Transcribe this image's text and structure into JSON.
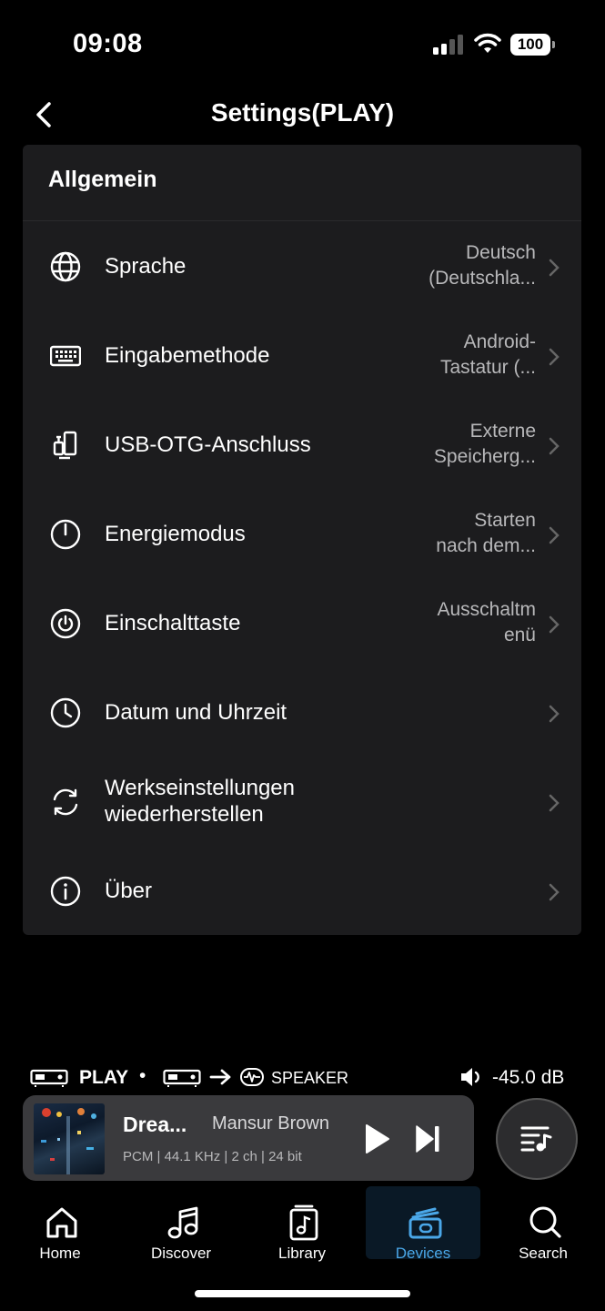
{
  "status_bar": {
    "time": "09:08",
    "battery": "100"
  },
  "header": {
    "title": "Settings(PLAY)"
  },
  "section": {
    "title": "Allgemein"
  },
  "settings": [
    {
      "label": "Sprache",
      "value_line1": "Deutsch",
      "value_line2": "(Deutschla...",
      "icon": "globe-icon"
    },
    {
      "label": "Eingabemethode",
      "value_line1": "Android-",
      "value_line2": "Tastatur (...",
      "icon": "keyboard-icon"
    },
    {
      "label": "USB-OTG-Anschluss",
      "value_line1": "Externe",
      "value_line2": "Speicherg...",
      "icon": "usb-device-icon"
    },
    {
      "label": "Energiemodus",
      "value_line1": "Starten",
      "value_line2": "nach dem...",
      "icon": "power-icon"
    },
    {
      "label": "Einschalttaste",
      "value_line1": "Ausschaltm",
      "value_line2": "enü",
      "icon": "power-button-icon"
    },
    {
      "label": "Datum und Uhrzeit",
      "value_line1": "",
      "value_line2": "",
      "icon": "clock-icon"
    },
    {
      "label_line1": "Werkseinstellungen",
      "label_line2": "wiederherstellen",
      "icon": "reset-icon"
    },
    {
      "label": "Über",
      "value_line1": "",
      "value_line2": "",
      "icon": "info-icon"
    }
  ],
  "output_chain": {
    "device": "PLAY",
    "separator": "•",
    "target": "SPEAKER",
    "volume": "-45.0 dB"
  },
  "player": {
    "title": "Drea...",
    "artist": "Mansur Brown",
    "meta": "PCM | 44.1 KHz | 2 ch | 24 bit"
  },
  "tabs": [
    {
      "label": "Home",
      "icon": "home-icon"
    },
    {
      "label": "Discover",
      "icon": "music-note-icon"
    },
    {
      "label": "Library",
      "icon": "library-icon"
    },
    {
      "label": "Devices",
      "icon": "devices-icon",
      "active": true
    },
    {
      "label": "Search",
      "icon": "search-icon"
    }
  ],
  "colors": {
    "card": "#1c1c1e",
    "accent": "#4aa7e8",
    "secondary_text": "#b8b8ba"
  }
}
